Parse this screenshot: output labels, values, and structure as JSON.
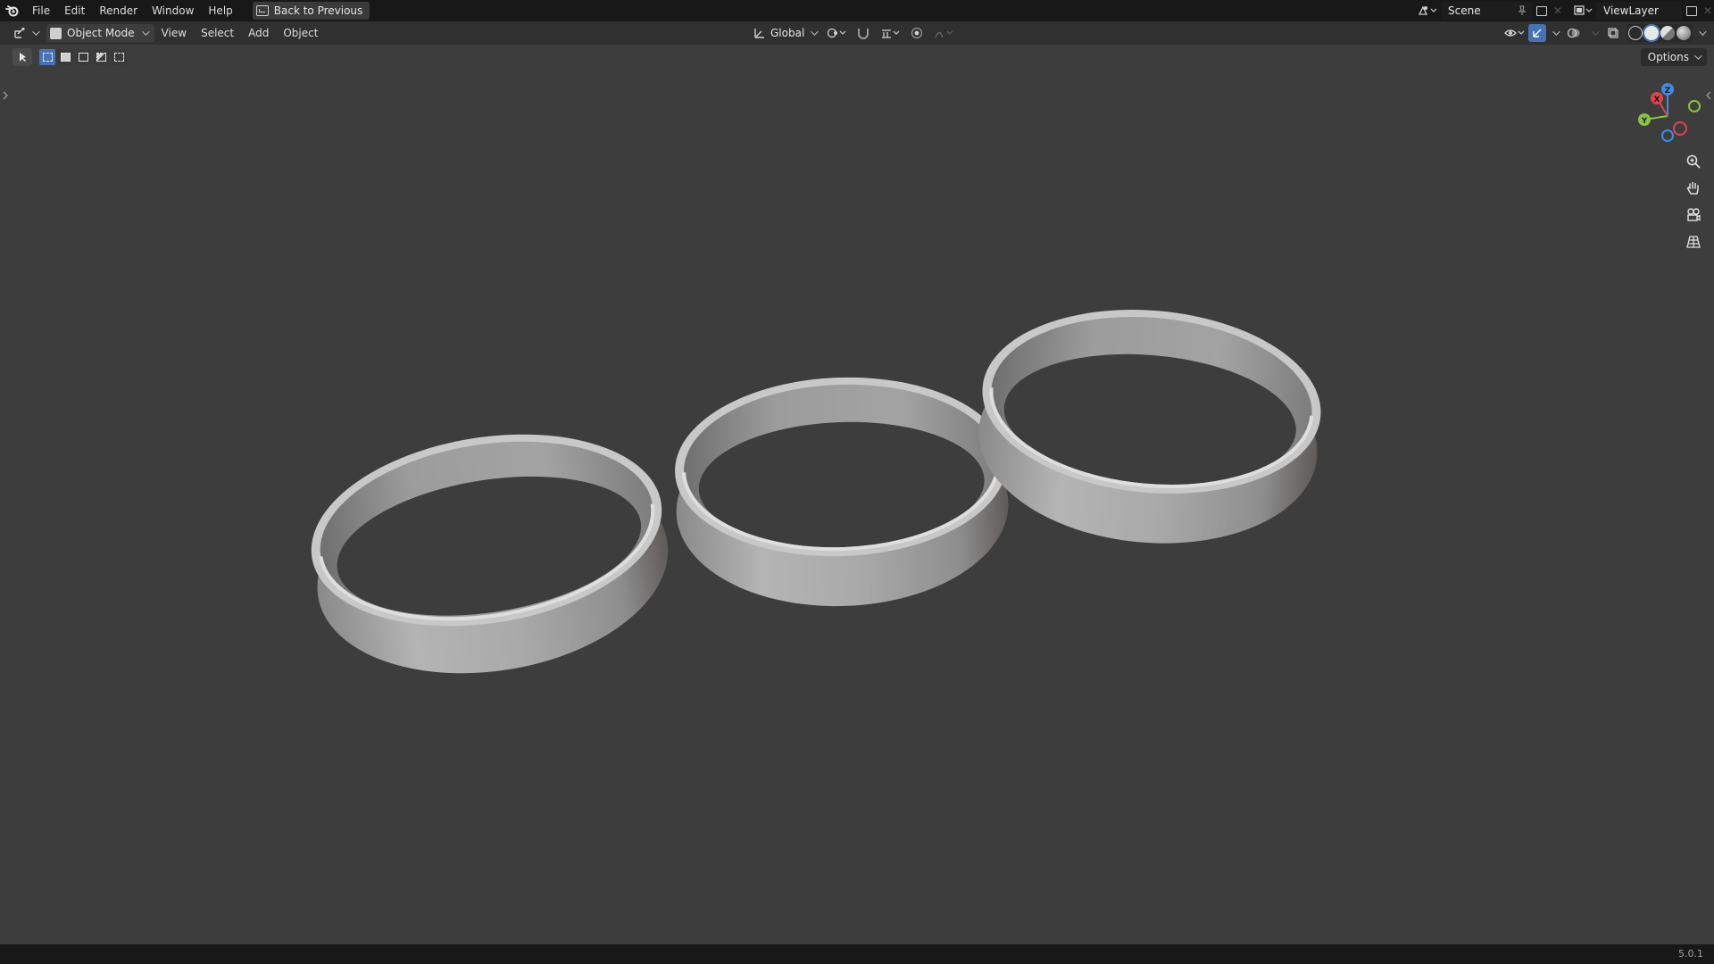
{
  "topbar": {
    "menus": [
      "File",
      "Edit",
      "Render",
      "Window",
      "Help"
    ],
    "back_label": "Back to Previous",
    "scene_name": "Scene",
    "view_layer": "ViewLayer"
  },
  "header": {
    "mode": "Object Mode",
    "menus": [
      "View",
      "Select",
      "Add",
      "Object"
    ],
    "orientation": "Global"
  },
  "viewport": {
    "options_label": "Options",
    "gizmo_axes": [
      "X",
      "Y",
      "Z"
    ],
    "objects": [
      "ring",
      "ring",
      "ring"
    ]
  },
  "status": {
    "version": "5.0.1"
  },
  "colors": {
    "background": "#3d3d3d",
    "topbar": "#181818",
    "header": "#303030",
    "accent": "#4772b3",
    "axis_x": "#d9474f",
    "axis_y": "#8ac33f",
    "axis_z": "#3f8ce0"
  }
}
